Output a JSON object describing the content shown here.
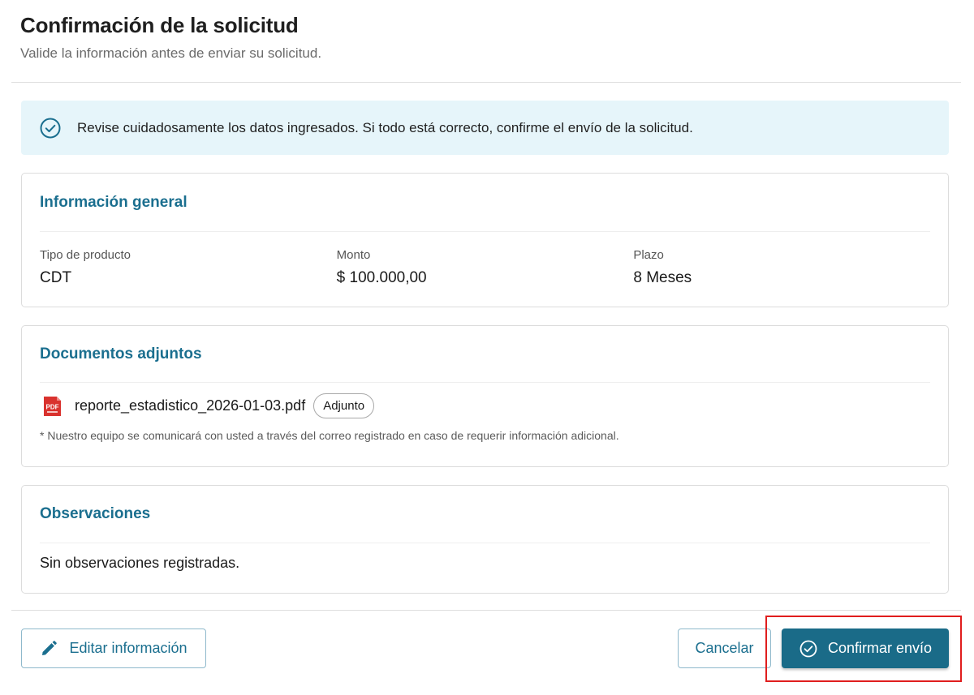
{
  "header": {
    "title": "Confirmación de la solicitud",
    "subtitle": "Valide la información antes de enviar su solicitud."
  },
  "alert": {
    "icon": "check-circle-icon",
    "text": "Revise cuidadosamente los datos ingresados. Si todo está correcto, confirme el envío de la solicitud."
  },
  "general": {
    "title": "Información general",
    "fields": [
      {
        "label": "Tipo de producto",
        "value": "CDT"
      },
      {
        "label": "Monto",
        "value": "$ 100.000,00"
      },
      {
        "label": "Plazo",
        "value": "8 Meses"
      }
    ]
  },
  "documents": {
    "title": "Documentos adjuntos",
    "items": [
      {
        "icon": "pdf-file-icon",
        "name": "reporte_estadistico_2026-01-03.pdf",
        "badge": "Adjunto"
      }
    ],
    "note": "* Nuestro equipo se comunicará con usted a través del correo registrado en caso de requerir información adicional."
  },
  "observations": {
    "title": "Observaciones",
    "text": "Sin observaciones registradas."
  },
  "actions": {
    "edit_label": "Editar información",
    "edit_icon": "pencil-icon",
    "cancel_label": "Cancelar",
    "confirm_label": "Confirmar envío",
    "confirm_icon": "check-circle-icon"
  },
  "colors": {
    "accent": "#1b6f8f",
    "primary_button": "#1a6b88",
    "alert_background": "#e6f5fa",
    "highlight": "#e01e1e",
    "pdf_red": "#d9322e"
  }
}
